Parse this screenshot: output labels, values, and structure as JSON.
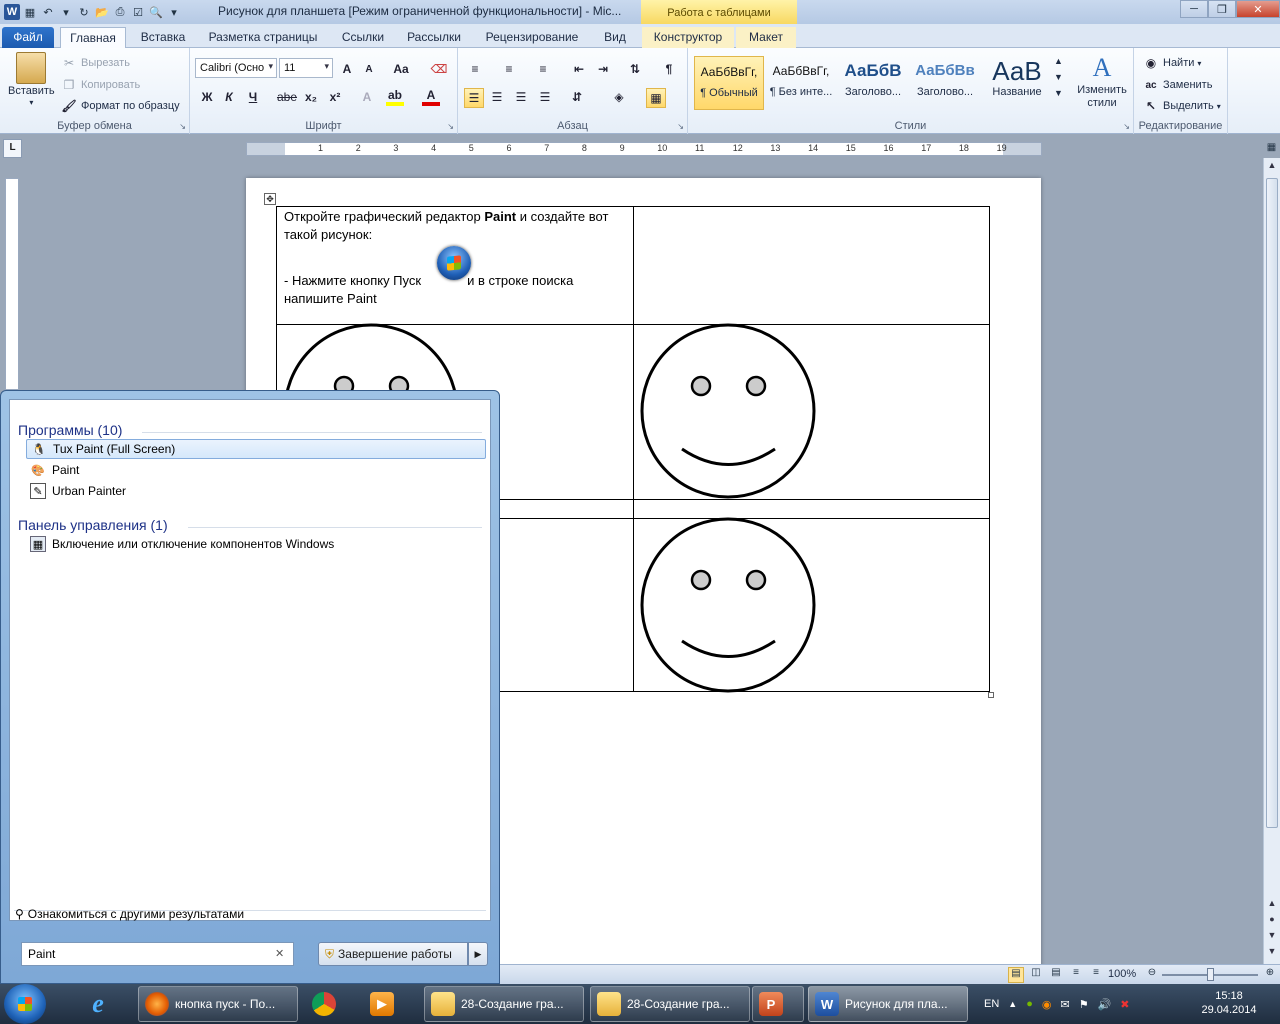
{
  "window": {
    "title": "Рисунок для планшета [Режим ограниченной функциональности]  -  Mic...",
    "context_tab_header": "Работа с таблицами"
  },
  "tabs": [
    {
      "label": "Файл"
    },
    {
      "label": "Главная"
    },
    {
      "label": "Вставка"
    },
    {
      "label": "Разметка страницы"
    },
    {
      "label": "Ссылки"
    },
    {
      "label": "Рассылки"
    },
    {
      "label": "Рецензирование"
    },
    {
      "label": "Вид"
    },
    {
      "label": "Конструктор"
    },
    {
      "label": "Макет"
    }
  ],
  "ribbon": {
    "clipboard": {
      "label": "Буфер обмена",
      "paste": "Вставить",
      "cut": "Вырезать",
      "copy": "Копировать",
      "format_painter": "Формат по образцу"
    },
    "font": {
      "label": "Шрифт",
      "font_name": "Calibri (Осно",
      "font_size": "11",
      "bold": "Ж",
      "italic": "К",
      "underline": "Ч",
      "strike": "abe",
      "grow": "A",
      "shrink": "A",
      "case": "Aa"
    },
    "paragraph": {
      "label": "Абзац"
    },
    "styles": {
      "label": "Стили",
      "items": [
        {
          "preview": "АаБбВвГг,",
          "name": "¶ Обычный"
        },
        {
          "preview": "АаБбВвГг,",
          "name": "¶ Без инте..."
        },
        {
          "preview": "АаБбВ",
          "name": "Заголово..."
        },
        {
          "preview": "АаБбВв",
          "name": "Заголово..."
        },
        {
          "preview": "АаВ",
          "name": "Название"
        }
      ],
      "change_styles": "Изменить стили"
    },
    "editing": {
      "label": "Редактирование",
      "find": "Найти",
      "replace": "Заменить",
      "select": "Выделить"
    }
  },
  "ruler": {
    "numbers": [
      "1",
      "2",
      "3",
      "4",
      "5",
      "6",
      "7",
      "8",
      "9",
      "10",
      "11",
      "12",
      "13",
      "14",
      "15",
      "16",
      "17",
      "18",
      "19"
    ]
  },
  "document": {
    "line1_pre": "Откройте графический редактор ",
    "line1_bold": "Paint",
    "line1_post": " и создайте вот",
    "line2": "такой рисунок:",
    "line3_pre": "- Нажмите  кнопку Пуск",
    "line3_post": "и в строке поиска",
    "line4": "напишите Paint"
  },
  "start_menu": {
    "programs_header": "Программы (10)",
    "programs": [
      {
        "label": "Tux Paint (Full Screen)",
        "icon": "tux-icon"
      },
      {
        "label": "Paint",
        "icon": "paint-icon"
      },
      {
        "label": "Urban Painter",
        "icon": "urban-painter-icon"
      }
    ],
    "control_panel_header": "Панель управления (1)",
    "control_panel": [
      {
        "label": "Включение или отключение компонентов Windows",
        "icon": "windows-features-icon"
      }
    ],
    "more_results": "Ознакомиться с другими результатами",
    "search_value": "Paint",
    "shutdown": "Завершение работы"
  },
  "statusbar": {
    "zoom": "100%"
  },
  "taskbar": {
    "items": [
      {
        "label": "кнопка пуск - По...",
        "icon": "firefox-icon"
      },
      {
        "label": "28-Создание гра...",
        "icon": "folder-icon"
      },
      {
        "label": "28-Создание гра...",
        "icon": "folder-icon"
      },
      {
        "label": "Рисунок для пла...",
        "icon": "word-icon"
      }
    ],
    "language": "EN",
    "time": "15:18",
    "date": "29.04.2014"
  }
}
